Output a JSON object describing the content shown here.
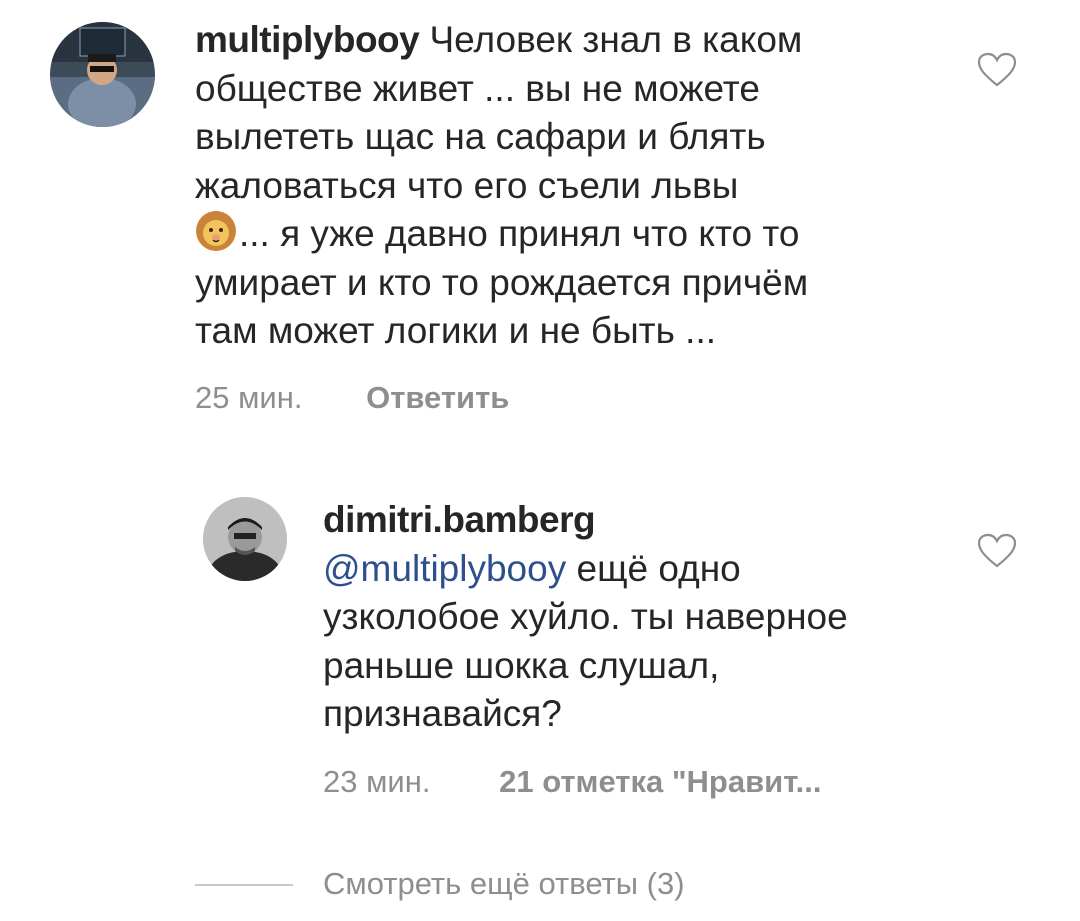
{
  "comments": [
    {
      "username": "multiplybooy",
      "text_line1": "Человек знал в каком",
      "text_line2": "обществе живет ... вы не можете",
      "text_line3": "вылететь щас на сафари и блять",
      "text_line4": "жаловаться что его съели львы",
      "text_line5_after_emoji": "... я уже давно принял что кто то",
      "text_line6": "умирает  и кто то рождается причём",
      "text_line7": "там может логики и не быть ...",
      "emoji": "lion-face",
      "time": "25 мин.",
      "reply_label": "Ответить"
    }
  ],
  "reply": {
    "username": "dimitri.bamberg",
    "mention": "@multiplybooy",
    "text_line1_after_mention": " ещё одно",
    "text_line2": "узколобое хуйло. ты наверное",
    "text_line3": "раньше шокка слушал,",
    "text_line4": "признавайся?",
    "time": "23 мин.",
    "likes_label": "21 отметка \"Нравит..."
  },
  "more_replies_label": "Смотреть ещё ответы (3)",
  "colors": {
    "text": "#262626",
    "meta": "#8e8e8e",
    "mention": "#2d4f8c",
    "divider": "#c7c7c7"
  },
  "icons": [
    "heart-outline-icon",
    "lion-emoji-icon"
  ]
}
